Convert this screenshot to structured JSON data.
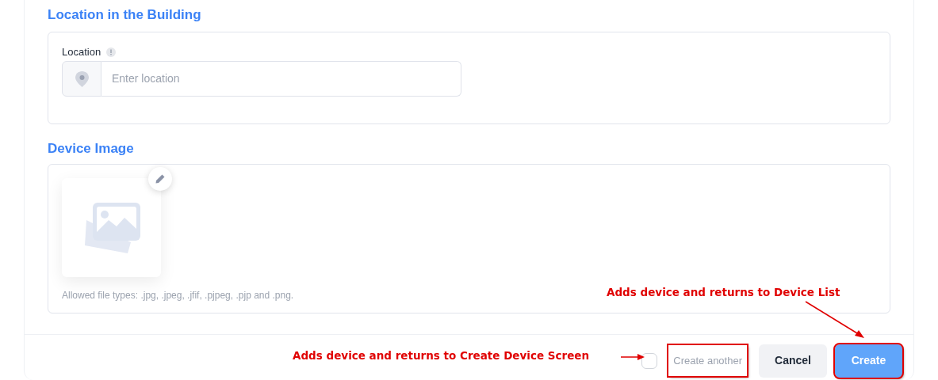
{
  "location_section": {
    "title": "Location in the Building",
    "field": {
      "label": "Location",
      "placeholder": "Enter location"
    }
  },
  "image_section": {
    "title": "Device Image",
    "hint": "Allowed file types: .jpg, .jpeg, .jfif, .pjpeg, .pjp and .png."
  },
  "footer": {
    "create_another": {
      "label": "Create another",
      "checked": false
    },
    "buttons": [
      {
        "label": "Cancel",
        "kind": "secondary"
      },
      {
        "label": "Create",
        "kind": "primary"
      }
    ]
  },
  "annotations": [
    {
      "text": "Adds device and returns to Device List",
      "kind": "diagonal"
    },
    {
      "text": "Adds device and returns to Create Device Screen",
      "kind": "straight"
    }
  ]
}
